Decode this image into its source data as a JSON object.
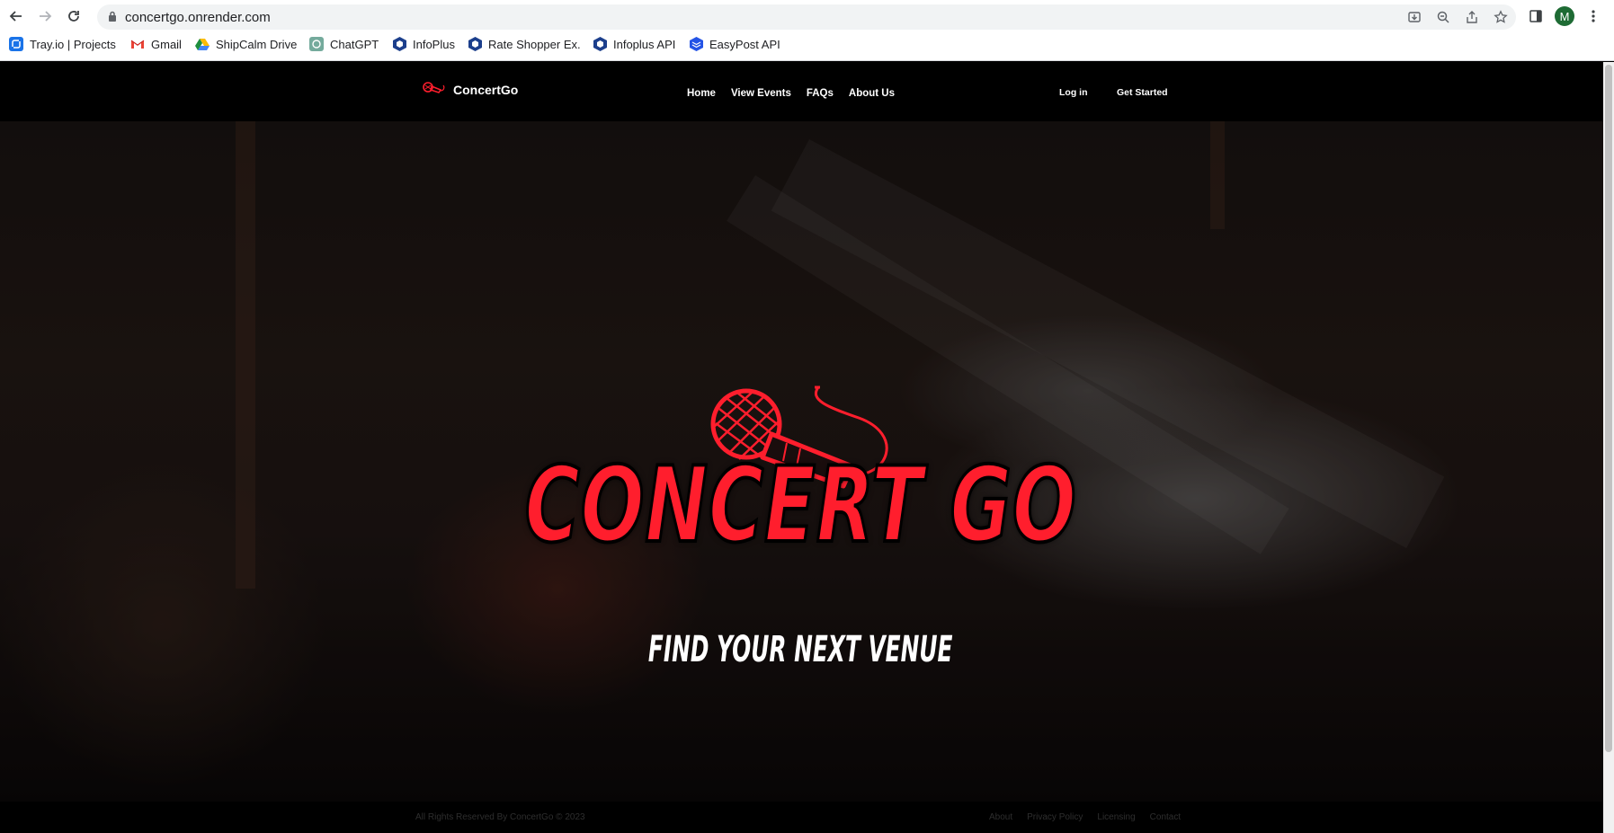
{
  "browser": {
    "url": "concertgo.onrender.com",
    "profile_initial": "M",
    "bookmarks": [
      {
        "label": "Tray.io | Projects",
        "icon": "tray-icon"
      },
      {
        "label": "Gmail",
        "icon": "gmail-icon"
      },
      {
        "label": "ShipCalm Drive",
        "icon": "drive-icon"
      },
      {
        "label": "ChatGPT",
        "icon": "chatgpt-icon"
      },
      {
        "label": "InfoPlus",
        "icon": "infoplus-icon"
      },
      {
        "label": "Rate Shopper Ex.",
        "icon": "infoplus-icon"
      },
      {
        "label": "Infoplus API",
        "icon": "infoplus-icon"
      },
      {
        "label": "EasyPost API",
        "icon": "easypost-icon"
      }
    ]
  },
  "site": {
    "brand": "ConcertGo",
    "nav": [
      "Home",
      "View Events",
      "FAQs",
      "About Us"
    ],
    "login": "Log in",
    "get_started": "Get Started"
  },
  "hero": {
    "title": "CONCERT GO",
    "tagline": "FIND YOUR NEXT VENUE"
  },
  "footer": {
    "copyright": "All Rights Reserved By ConcertGo © 2023",
    "links": [
      "About",
      "Privacy Policy",
      "Licensing",
      "Contact"
    ]
  },
  "colors": {
    "accent": "#ff1e2d",
    "background": "#000000"
  }
}
